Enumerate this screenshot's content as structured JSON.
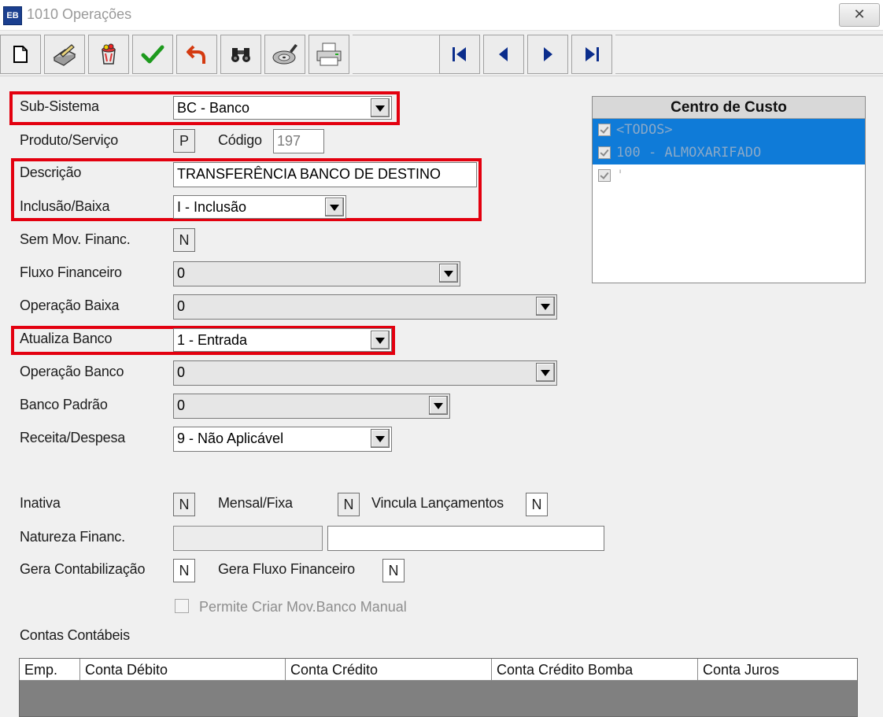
{
  "window": {
    "app_icon_text": "EB",
    "title": "1010 Operações",
    "close_glyph": "✕"
  },
  "toolbar": {
    "buttons": [
      "new-document-icon",
      "edit-pen-icon",
      "delete-bucket-icon",
      "confirm-check-icon",
      "undo-arrow-icon",
      "binoculars-icon",
      "cd-disc-icon",
      "printer-icon"
    ],
    "nav": [
      "first-record-icon",
      "previous-record-icon",
      "next-record-icon",
      "last-record-icon"
    ]
  },
  "form": {
    "sub_sistema": {
      "label": "Sub-Sistema",
      "value": "BC - Banco"
    },
    "produto_servico": {
      "label": "Produto/Serviço",
      "value": "P"
    },
    "codigo": {
      "label": "Código",
      "value": "197"
    },
    "descricao": {
      "label": "Descrição",
      "value": "TRANSFERÊNCIA BANCO DE DESTINO"
    },
    "inclusao_baixa": {
      "label": "Inclusão/Baixa",
      "value": "I - Inclusão"
    },
    "sem_mov_financ": {
      "label": "Sem Mov. Financ.",
      "value": "N"
    },
    "fluxo_financeiro": {
      "label": "Fluxo Financeiro",
      "value": "0"
    },
    "operacao_baixa": {
      "label": "Operação Baixa",
      "value": "0"
    },
    "atualiza_banco": {
      "label": "Atualiza Banco",
      "value": "1 - Entrada"
    },
    "operacao_banco": {
      "label": "Operação Banco",
      "value": "0"
    },
    "banco_padrao": {
      "label": "Banco Padrão",
      "value": "0"
    },
    "receita_despesa": {
      "label": "Receita/Despesa",
      "value": "9 - Não Aplicável"
    },
    "inativa": {
      "label": "Inativa",
      "value": "N"
    },
    "mensal_fixa": {
      "label": "Mensal/Fixa",
      "value": "N"
    },
    "vincula_lancamentos": {
      "label": "Vincula Lançamentos",
      "value": "N"
    },
    "natureza_financ": {
      "label": "Natureza Financ.",
      "code": "",
      "desc": ""
    },
    "gera_contabilizacao": {
      "label": "Gera Contabilização",
      "value": "N"
    },
    "gera_fluxo_financeiro": {
      "label": "Gera Fluxo Financeiro",
      "value": "N"
    },
    "permite_criar_mov": {
      "label": "Permite Criar Mov.Banco Manual"
    },
    "contas_contabeis": {
      "label": "Contas Contábeis"
    }
  },
  "centro_custo": {
    "title": "Centro de Custo",
    "items": [
      "<TODOS>",
      "100 - ALMOXARIFADO",
      "'"
    ]
  },
  "grid": {
    "columns": [
      "Emp.",
      "Conta Débito",
      "Conta Crédito",
      "Conta Crédito Bomba",
      "Conta Juros"
    ]
  },
  "colors": {
    "highlight": "#e3000f",
    "selection": "#0f7bd8"
  }
}
